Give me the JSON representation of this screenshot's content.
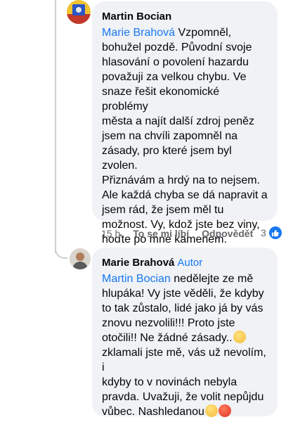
{
  "comment1": {
    "author": "Martin Bocian",
    "mention": "Marie Brahová",
    "lines": [
      " Vzpomněl,",
      "bohužel pozdě. Původní svoje",
      "hlasování o povolení hazardu",
      "považuji za velkou chybu. Ve",
      "snaze řešit ekonomické problémy",
      "města a najít další zdroj peněz",
      "jsem na chvíli zapomněl na",
      "zásady, pro které jsem byl zvolen.",
      "Přiznávám a hrdý na to nejsem.",
      "Ale každá chyba se dá napravit a",
      "jsem rád, že jsem měl tu",
      "možnost. Vy, kdož jste bez viny,",
      "hoďte po mne kamenem."
    ],
    "time": "15 h",
    "like_label": "To se mi líbí",
    "reply_label": "Odpovědět",
    "reaction_count": "3"
  },
  "comment2": {
    "author": "Marie Brahová",
    "badge": "Autor",
    "mention": "Martin Bocian",
    "lines": [
      " nedělejte ze mě",
      "hlupáka! Vy jste věděli, že kdyby",
      "to tak zůstalo, lidé jako já by vás",
      "znovu nezvolili!!! Proto jste",
      "otočili!! Ne žádné zásady..",
      "zklamali jste mě, vás už nevolím, i",
      "kdyby to v novinách nebyla",
      "pravda. Uvažuji, že volit nepůjdu",
      "vůbec. Nashledanou"
    ]
  },
  "colors": {
    "accent": "#1877f2",
    "bubble": "#f0f2f5",
    "muted": "#65676b"
  }
}
